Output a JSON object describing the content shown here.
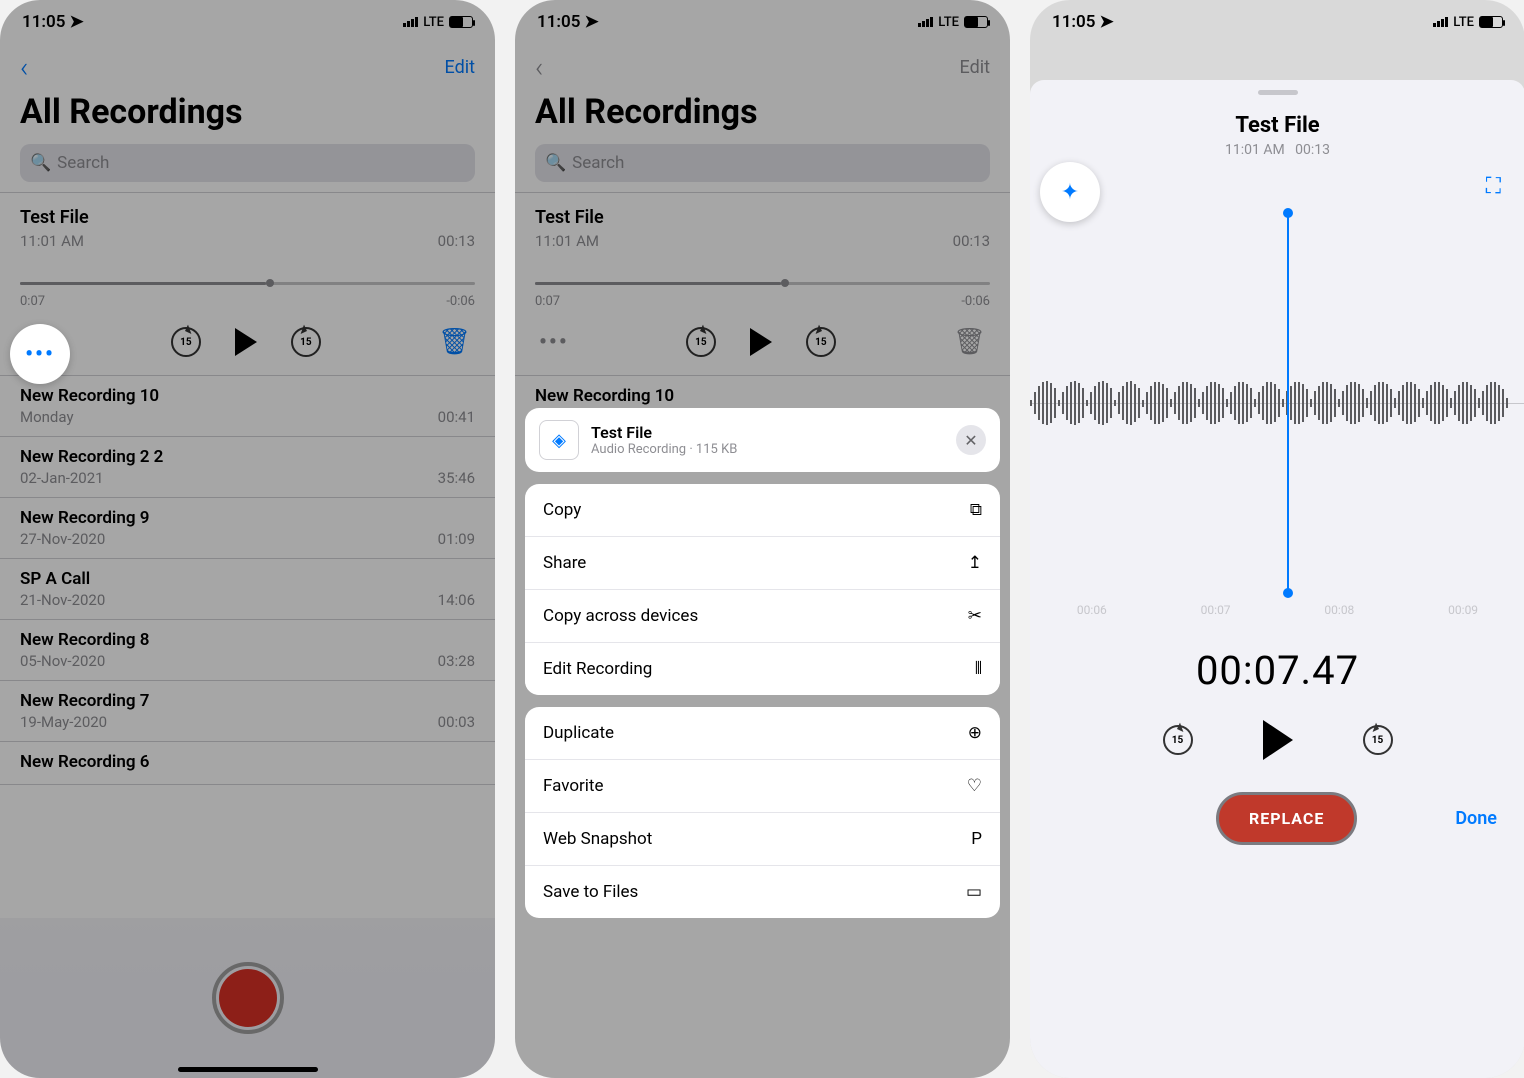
{
  "status": {
    "time": "11:05",
    "network": "LTE"
  },
  "nav": {
    "edit": "Edit"
  },
  "title": "All Recordings",
  "search": {
    "placeholder": "Search"
  },
  "selected": {
    "name": "Test File",
    "subtitle": "11:01 AM",
    "duration": "00:13",
    "scrub_left": "0:07",
    "scrub_right": "-0:06",
    "progress_pct": 54
  },
  "list": [
    {
      "name": "New Recording 10",
      "sub": "Monday",
      "dur": "00:41"
    },
    {
      "name": "New Recording 2 2",
      "sub": "02-Jan-2021",
      "dur": "35:46"
    },
    {
      "name": "New Recording 9",
      "sub": "27-Nov-2020",
      "dur": "01:09"
    },
    {
      "name": "SP A Call",
      "sub": "21-Nov-2020",
      "dur": "14:06"
    },
    {
      "name": "New Recording 8",
      "sub": "05-Nov-2020",
      "dur": "03:28"
    },
    {
      "name": "New Recording 7",
      "sub": "19-May-2020",
      "dur": "00:03"
    },
    {
      "name": "New Recording 6",
      "sub": "",
      "dur": ""
    }
  ],
  "sheet": {
    "header_label": "New Recording 10",
    "file_name": "Test File",
    "file_meta": "Audio Recording · 115 KB",
    "items_a": [
      {
        "label": "Copy",
        "icon": "⧉"
      },
      {
        "label": "Share",
        "icon": "↥"
      },
      {
        "label": "Copy across devices",
        "icon": "✂"
      },
      {
        "label": "Edit Recording",
        "icon": "⫴"
      }
    ],
    "items_b": [
      {
        "label": "Duplicate",
        "icon": "⊕"
      },
      {
        "label": "Favorite",
        "icon": "♡"
      },
      {
        "label": "Web Snapshot",
        "icon": "P"
      },
      {
        "label": "Save to Files",
        "icon": "▭"
      }
    ]
  },
  "editor": {
    "title": "Test File",
    "sub_left": "11:01 AM",
    "sub_right": "00:13",
    "ruler": [
      "00:06",
      "00:07",
      "00:08",
      "00:09"
    ],
    "time_display": "00:07.47",
    "replace": "REPLACE",
    "done": "Done",
    "cursor_pct": 52
  },
  "skip_label": "15"
}
